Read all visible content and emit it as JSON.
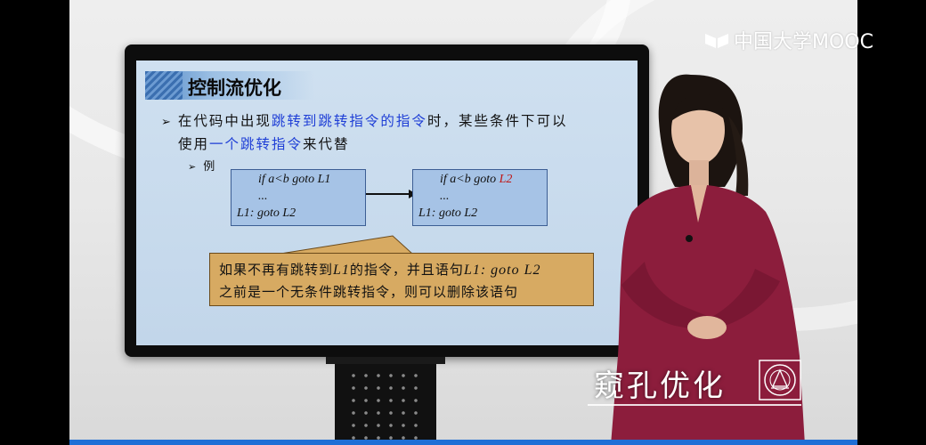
{
  "logo": {
    "text": "中国大学MOOC"
  },
  "slide": {
    "title": "控制流优化",
    "bullet1": {
      "line1_pre": "在代码中出现",
      "line1_hl": "跳转到跳转指令的指令",
      "line1_post": "时，某些条件下可以",
      "line2_pre": "使用",
      "line2_hl": "一个跳转指令",
      "line2_post": "来代替"
    },
    "example_label": "例",
    "code_before": {
      "line1": "if a<b goto L1",
      "line2": "...",
      "line3": "L1: goto L2"
    },
    "code_after": {
      "line1_pre": "if a<b goto ",
      "line1_red": "L2",
      "line2": "...",
      "line3": "L1: goto L2"
    },
    "callout": {
      "l1_a": "如果不再有跳转到",
      "l1_b": "L1",
      "l1_c": "的指令，并且语句",
      "l1_d": "L1: goto L2",
      "line2": "之前是一个无条件跳转指令，则可以删除该语句"
    }
  },
  "caption": {
    "text": "窥孔优化"
  },
  "colors": {
    "highlight": "#1f3fd6",
    "highlight_red": "#c01818",
    "code_box": "#a6c3e6",
    "callout": "#d7aa62",
    "progress": "#1f6fd6"
  }
}
